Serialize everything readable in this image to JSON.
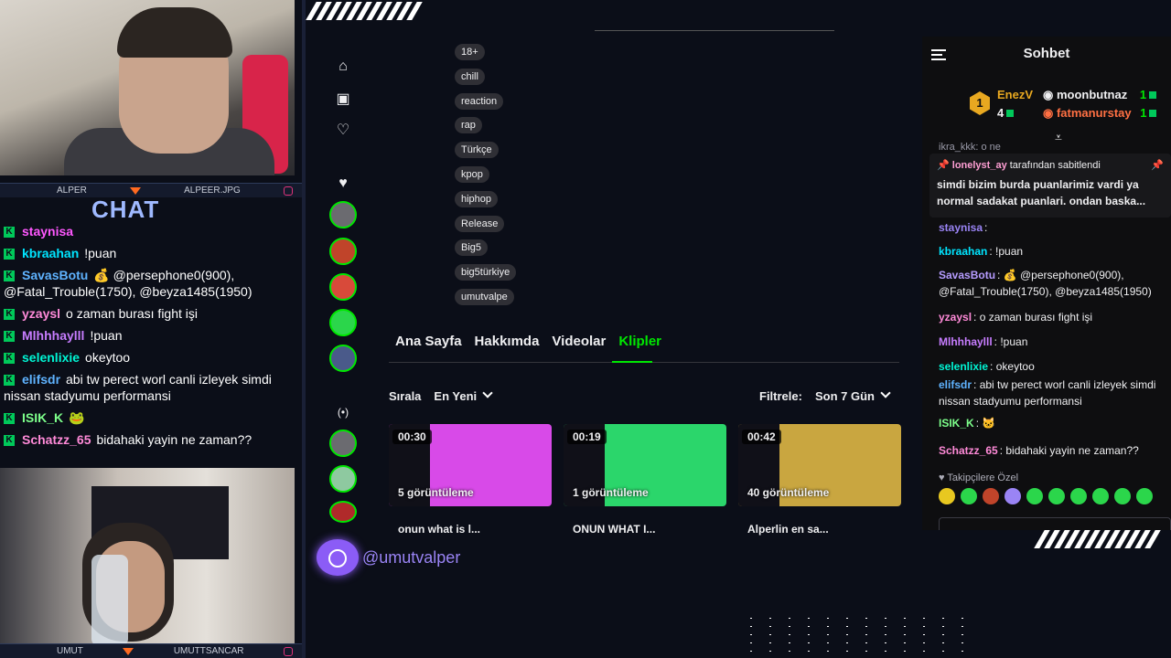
{
  "overlay": {
    "cam_top_label_left": "ALPER",
    "cam_top_label_right": "ALPEER.JPG",
    "chat_title": "CHAT",
    "cam_bottom_label_left": "UMUT",
    "cam_bottom_label_right": "UMUTTSANCAR",
    "chat": [
      {
        "user": "staynisa",
        "color": "#ff58ff",
        "msg": ""
      },
      {
        "user": "kbraahan",
        "color": "#00e5ff",
        "msg": "!puan"
      },
      {
        "user": "SavasBotu",
        "color": "#5fb3ff",
        "msg": "💰 @persephone0(900), @Fatal_Trouble(1750), @beyza1485(1950)"
      },
      {
        "user": "yzaysl",
        "color": "#ff8ad8",
        "msg": "o zaman burası fight işi"
      },
      {
        "user": "Mlhhhaylll",
        "color": "#c77dff",
        "msg": "!puan"
      },
      {
        "user": "selenlixie",
        "color": "#00f5d4",
        "msg": "okeytoo"
      },
      {
        "user": "elifsdr",
        "color": "#5fb3ff",
        "msg": "abi tw perect worl canli izleyek simdi nissan stadyumu performansi"
      },
      {
        "user": "ISIK_K",
        "color": "#7dff8b",
        "msg": "🐸"
      },
      {
        "user": "Schatzz_65",
        "color": "#ff8ad8",
        "msg": "bidahaki yayin ne zaman??"
      }
    ],
    "footer_handle": "@umutvalper"
  },
  "nav": {
    "home_icon": "home-icon",
    "following_icon": "following-icon",
    "heart_icon": "heart-icon",
    "live_icon": "live-icon"
  },
  "tags": [
    "18+",
    "chill",
    "reaction",
    "rap",
    "Türkçe",
    "kpop",
    "hiphop",
    "Release",
    "Big5",
    "big5türkiye",
    "umutvalpe"
  ],
  "tabs": [
    "Ana Sayfa",
    "Hakkımda",
    "Videolar",
    "Klipler"
  ],
  "active_tab": "Klipler",
  "sort": {
    "label": "Sırala",
    "value": "En Yeni"
  },
  "filter": {
    "label": "Filtrele:",
    "value": "Son 7 Gün"
  },
  "clips": [
    {
      "duration": "00:30",
      "views": "5 görüntüleme",
      "title": "onun what is l...",
      "color": "#d84ae8"
    },
    {
      "duration": "00:19",
      "views": "1 görüntüleme",
      "title": "ONUN WHAT I...",
      "color": "#2bd66b"
    },
    {
      "duration": "00:42",
      "views": "40 görüntüleme",
      "title": "Alperlin en sa...",
      "color": "#c9a640"
    }
  ],
  "chat_panel": {
    "title": "Sohbet",
    "leader_1": {
      "name": "EnezV",
      "rank": "1",
      "count": "4"
    },
    "leader_2": {
      "name": "moonbutnaz",
      "count": "1"
    },
    "leader_3": {
      "name": "fatmanurstay",
      "count": "1"
    },
    "partial_msg": "ikra_kkk: o ne",
    "pinned_by": "lonelyst_ay",
    "pinned_by_suffix": "tarafından sabitlendi",
    "pinned_msg": "simdi bizim burda puanlarimiz vardi ya normal sadakat puanlari. ondan baska...",
    "messages": [
      {
        "user": "staynisa",
        "color": "#9a84f5",
        "msg": ""
      },
      {
        "user": "kbraahan",
        "color": "#00e5ff",
        "msg": "!puan"
      },
      {
        "user": "SavasBotu",
        "color": "#b69cff",
        "msg": "💰 @persephone0(900), @Fatal_Trouble(1750), @beyza1485(1950)"
      },
      {
        "user": "yzaysl",
        "color": "#ff8ad8",
        "msg": "o zaman burası fight işi"
      },
      {
        "user": "Mlhhhaylll",
        "color": "#c77dff",
        "msg": "!puan"
      },
      {
        "user": "selenlixie",
        "color": "#00f5d4",
        "msg": "okeytoo"
      },
      {
        "user": "elifsdr",
        "color": "#5fb3ff",
        "msg": "abi tw perect worl canli izleyek simdi nissan stadyumu performansi"
      },
      {
        "user": "ISIK_K",
        "color": "#7dff8b",
        "msg": "🐱"
      },
      {
        "user": "Schatzz_65",
        "color": "#ff8ad8",
        "msg": "bidahaki yayin ne zaman??"
      }
    ],
    "followers_only": "Takipçilere Özel"
  },
  "colors": {
    "accent": "#00e701",
    "bg": "#0b0e18",
    "panel": "#0e0e10",
    "brand_purple": "#8b5cf6"
  }
}
